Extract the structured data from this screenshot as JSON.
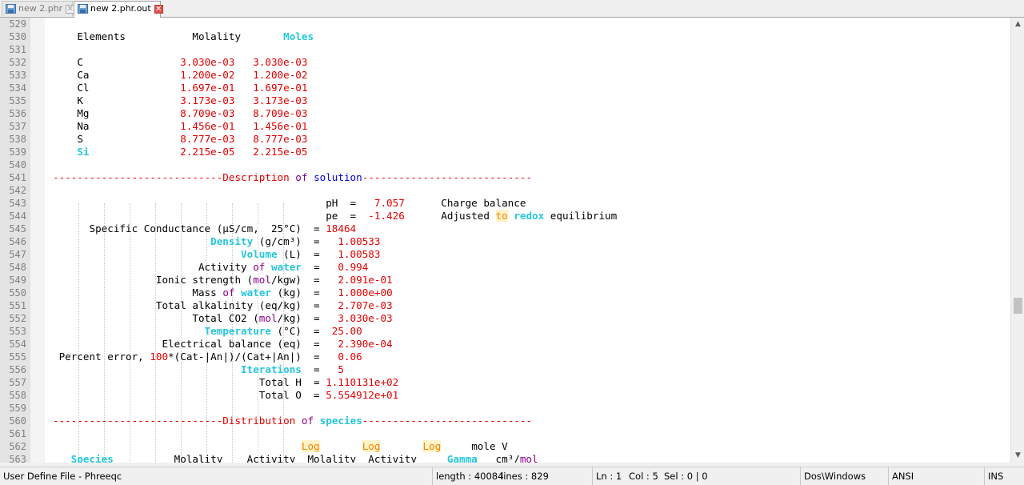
{
  "tabs": [
    {
      "label": "new  2.phr",
      "active": false,
      "icon": "save-disk-icon"
    },
    {
      "label": "new  2.phr.out",
      "active": true,
      "icon": "save-disk-icon"
    }
  ],
  "gutter": {
    "line_numbers": [
      "529",
      "530",
      "531",
      "532",
      "533",
      "534",
      "535",
      "536",
      "537",
      "538",
      "539",
      "540",
      "541",
      "542",
      "543",
      "544",
      "545",
      "546",
      "547",
      "548",
      "549",
      "550",
      "551",
      "552",
      "553",
      "554",
      "555",
      "556",
      "557",
      "558",
      "559",
      "560",
      "561",
      "562",
      "563"
    ]
  },
  "editor": {
    "lines": [
      "",
      "    Elements           Molality       [[kw:Moles]]",
      "",
      "    C                [[r:3.030e-03   3.030e-03]]",
      "    Ca               [[r:1.200e-02   1.200e-02]]",
      "    Cl               [[r:1.697e-01   1.697e-01]]",
      "    K                [[r:3.173e-03   3.173e-03]]",
      "    Mg               [[r:8.709e-03   8.709e-03]]",
      "    Na               [[r:1.456e-01   1.456e-01]]",
      "    S                [[r:8.777e-03   8.777e-03]]",
      "    [[kw:Si]]               [[r:2.215e-05   2.215e-05]]",
      "",
      "[[r:----------------------------Description]] [[mg:of]] [[b:solution]][[r:----------------------------]]",
      "",
      "                                             pH  =   [[r:7.057]]      Charge balance",
      "                                             pe  =  [[r:-1.426]]      Adjusted [[ob:to]] [[kw:redox]] equilibrium",
      "      Specific Conductance (µS/cm,  25°C)  = [[r:18464]]",
      "                          [[kw:Density]] (g/cm³)  =   [[r:1.00533]]",
      "                               [[kw:Volume]] (L)  =   [[r:1.00583]]",
      "                        Activity [[mg:of]] [[kw:water]]  =   [[r:0.994]]",
      "                 Ionic strength ([[mg:mol]]/kgw)  =   [[r:2.091e-01]]",
      "                       Mass [[mg:of]] [[kw:water]] (kg)  =   [[r:1.000e+00]]",
      "                 Total alkalinity (eq/kg)  =   [[r:2.707e-03]]",
      "                       Total CO2 ([[mg:mol]]/kg)  =   [[r:3.030e-03]]",
      "                         [[kw:Temperature]] (°C)  =  [[r:25.00]]",
      "                  Electrical balance (eq)  =   [[r:2.390e-04]]",
      " Percent error, [[r:100]]*(Cat-|An|)/(Cat+|An|)  =   [[r:0.06]]",
      "                               [[kw:Iterations]]  =   [[r:5]]",
      "                                  Total H  = [[r:1.110131e+02]]",
      "                                  Total O  = [[r:5.554912e+01]]",
      "",
      "[[r:----------------------------Distribution]] [[mg:of]] [[kw:species]][[r:----------------------------]]",
      "",
      "                                         [[ob:Log]]       [[ob:Log]]       [[ob:Log]]     mole V",
      "   [[kw:Species]]          Molality    Activity  Molality  Activity     [[kw:Gamma]]   cm³/[[mg:mol]]"
    ]
  },
  "status": {
    "file_type": "User Define File - Phreeqc",
    "length": "length : 40084",
    "lines": "lines : 829",
    "ln": "Ln : 1",
    "col": "Col : 5",
    "sel": "Sel : 0 | 0",
    "eol": "Dos\\Windows",
    "encoding": "ANSI",
    "mode": "INS"
  },
  "colors": {
    "number_red": "#e00000",
    "keyword_cyan": "#26c6da",
    "operator_orange": "#ff8000",
    "word_blue": "#0000dd"
  }
}
